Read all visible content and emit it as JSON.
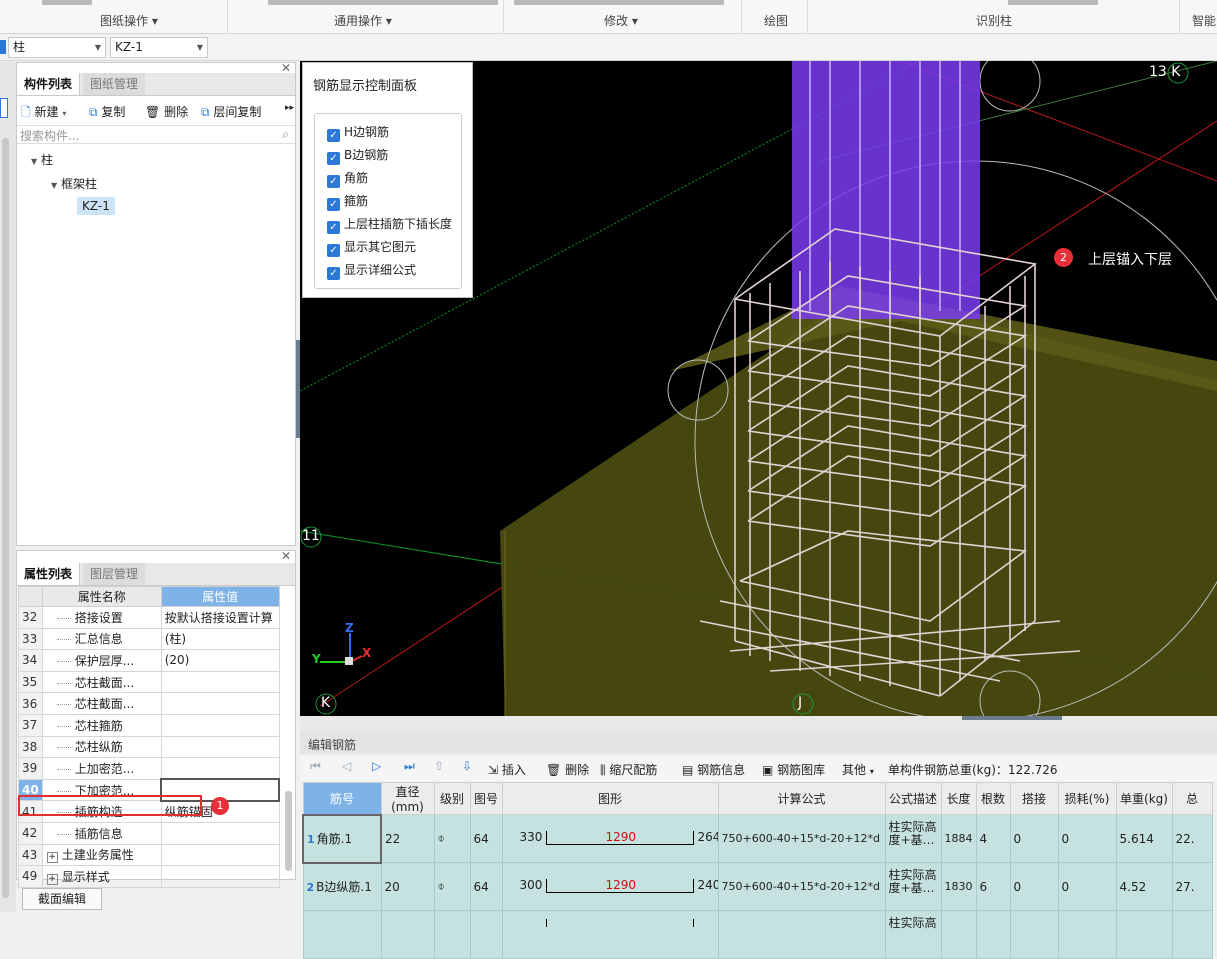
{
  "ribbon": {
    "groups": [
      "图纸操作",
      "通用操作",
      "修改",
      "绘图",
      "识别柱",
      "智能"
    ]
  },
  "toolbar": {
    "floor_combo": "柱",
    "component_combo": "KZ-1"
  },
  "component_panel": {
    "tabs": [
      "构件列表",
      "图纸管理"
    ],
    "new_label": "新建",
    "copy_label": "复制",
    "delete_label": "删除",
    "floor_copy_label": "层间复制",
    "search_placeholder": "搜索构件...",
    "tree": {
      "root": "柱",
      "child": "框架柱",
      "leaf": "KZ-1"
    }
  },
  "property_panel": {
    "tabs": [
      "属性列表",
      "图层管理"
    ],
    "col_name": "属性名称",
    "col_value": "属性值",
    "rows": [
      {
        "num": "32",
        "name": "搭接设置",
        "value": "按默认搭接设置计算"
      },
      {
        "num": "33",
        "name": "汇总信息",
        "value": "(柱)"
      },
      {
        "num": "34",
        "name": "保护层厚...",
        "value": "(20)"
      },
      {
        "num": "35",
        "name": "芯柱截面...",
        "value": ""
      },
      {
        "num": "36",
        "name": "芯柱截面...",
        "value": ""
      },
      {
        "num": "37",
        "name": "芯柱箍筋",
        "value": ""
      },
      {
        "num": "38",
        "name": "芯柱纵筋",
        "value": ""
      },
      {
        "num": "39",
        "name": "上加密范...",
        "value": ""
      },
      {
        "num": "40",
        "name": "下加密范...",
        "value": ""
      },
      {
        "num": "41",
        "name": "插筋构造",
        "value": "纵筋锚固"
      },
      {
        "num": "42",
        "name": "插筋信息",
        "value": ""
      },
      {
        "num": "43",
        "name": "土建业务属性",
        "value": ""
      },
      {
        "num": "49",
        "name": "显示样式",
        "value": ""
      }
    ],
    "section_edit_button": "截面编辑",
    "annotation_marker": "1"
  },
  "control_panel": {
    "title": "钢筋显示控制面板",
    "options": [
      {
        "label": "H边钢筋",
        "checked": true
      },
      {
        "label": "B边钢筋",
        "checked": true
      },
      {
        "label": "角筋",
        "checked": true
      },
      {
        "label": "箍筋",
        "checked": true
      },
      {
        "label": "上层柱插筋下插长度",
        "checked": true
      },
      {
        "label": "显示其它图元",
        "checked": true
      },
      {
        "label": "显示详细公式",
        "checked": true
      }
    ]
  },
  "viewport": {
    "annotation_marker": "2",
    "annotation_text": "上层锚入下层",
    "axis_labels": [
      "13 K",
      "11",
      "K",
      "J"
    ],
    "triad": {
      "x": "X",
      "y": "Y",
      "z": "Z"
    },
    "colors": {
      "column": "#7a3cf0",
      "foundation": "#4a4a10",
      "rebar": "#d9c8c8",
      "marker": "#e8303a"
    }
  },
  "edit_rebar": {
    "title": "编辑钢筋",
    "insert_label": "插入",
    "delete_label": "删除",
    "scale_label": "缩尺配筋",
    "info_label": "钢筋信息",
    "library_label": "钢筋图库",
    "other_label": "其他",
    "total_weight": "单构件钢筋总重(kg)：122.726",
    "columns": [
      "筋号",
      "直径(mm)",
      "级别",
      "图号",
      "图形",
      "计算公式",
      "公式描述",
      "长度",
      "根数",
      "搭接",
      "损耗(%)",
      "单重(kg)",
      "总"
    ],
    "rows": [
      {
        "idx": "1",
        "name": "角筋.1",
        "dia": "22",
        "grade": "⌽",
        "fig": "64",
        "left": "330",
        "mid": "1290",
        "right": "264",
        "formula": "750+600-40+15*d-20+12*d",
        "desc1": "柱实际高",
        "desc2": "度+基…",
        "length": "1884",
        "count": "4",
        "lap": "0",
        "loss": "0",
        "unit": "5.614",
        "total": "22."
      },
      {
        "idx": "2",
        "name": "B边纵筋.1",
        "dia": "20",
        "grade": "⌽",
        "fig": "64",
        "left": "300",
        "mid": "1290",
        "right": "240",
        "formula": "750+600-40+15*d-20+12*d",
        "desc1": "柱实际高",
        "desc2": "度+基…",
        "length": "1830",
        "count": "6",
        "lap": "0",
        "loss": "0",
        "unit": "4.52",
        "total": "27."
      },
      {
        "idx": "",
        "name": "",
        "dia": "",
        "grade": "",
        "fig": "",
        "left": "",
        "mid": "",
        "right": "",
        "formula": "",
        "desc1": "柱实际高",
        "desc2": "",
        "length": "",
        "count": "",
        "lap": "",
        "loss": "",
        "unit": "",
        "total": ""
      }
    ]
  }
}
